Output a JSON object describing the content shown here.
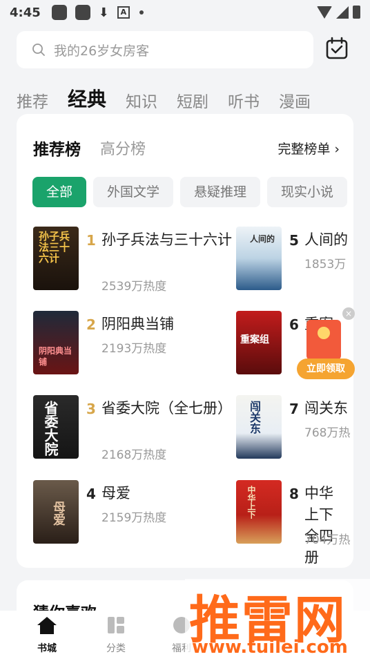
{
  "status_bar": {
    "time": "4:45"
  },
  "search": {
    "placeholder": "我的26岁女房客"
  },
  "top_tabs": [
    "推荐",
    "经典",
    "知识",
    "短剧",
    "听书",
    "漫画"
  ],
  "ranking": {
    "tab_active": "推荐榜",
    "tab_other": "高分榜",
    "full_list": "完整榜单",
    "chips": [
      "全部",
      "外国文学",
      "悬疑推理",
      "现实小说"
    ],
    "books": [
      {
        "rank": "1",
        "title": "孙子兵法与三十六计",
        "heat": "2539万热度",
        "cover_text": "孙子兵法三十六计"
      },
      {
        "rank": "2",
        "title": "阴阳典当铺",
        "heat": "2193万热度",
        "cover_text": "阴阳典当铺"
      },
      {
        "rank": "3",
        "title": "省委大院（全七册）",
        "heat": "2168万热度",
        "cover_text": "省委大院"
      },
      {
        "rank": "4",
        "title": "母爱",
        "heat": "2159万热度",
        "cover_text": "母爱"
      },
      {
        "rank": "5",
        "title": "人间的",
        "heat": "1853万",
        "cover_text": "人间的"
      },
      {
        "rank": "6",
        "title": "重案",
        "heat": "",
        "cover_text": "重案组"
      },
      {
        "rank": "7",
        "title": "闯关东",
        "heat": "768万热",
        "cover_text": "闯关东"
      },
      {
        "rank": "8",
        "title": "中华上下全四册",
        "heat": "704万热",
        "cover_text": "中华上下"
      }
    ]
  },
  "red_packet": {
    "button": "立即领取",
    "close": "×"
  },
  "next_section": {
    "title": "猜你喜欢"
  },
  "bottom_nav": [
    "书城",
    "分类",
    "福利"
  ],
  "watermark": {
    "big": "推雷网",
    "small": "www.tuilei.com"
  },
  "colors": {
    "accent": "#1aa36b",
    "rank_gold": "#d7a64a",
    "rank_dark": "#222222",
    "watermark": "#ff6a1a"
  }
}
